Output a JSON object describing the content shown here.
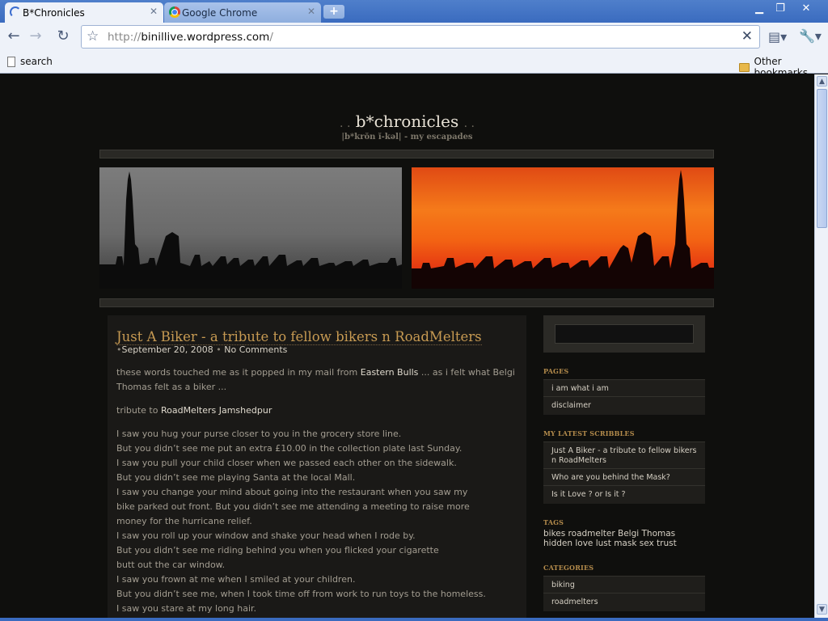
{
  "browser": {
    "tabs": [
      {
        "label": "B*Chronicles",
        "active": true
      },
      {
        "label": "Google Chrome",
        "active": false
      }
    ],
    "url_scheme": "http://",
    "url_host": "binillive.wordpress.com",
    "url_path": "/",
    "bookmarks": {
      "left_item": "search",
      "right_item": "Other bookmarks"
    }
  },
  "site": {
    "title_dots_left": ". .",
    "title": "b*chronicles",
    "title_dots_right": ". .",
    "subtitle": "|b*krŏn ĭ-kəl|  - my escapades"
  },
  "post": {
    "title": "Just A Biker - a tribute to fellow bikers n RoadMelters",
    "meta_bullet": "•",
    "date": "September 20, 2008",
    "meta_sep": "•",
    "comments": "No Comments",
    "intro_pre": "these words touched me as it popped in my mail from ",
    "intro_link": "Eastern Bulls",
    "intro_post": " ... as i felt what Belgi Thomas felt as a biker ...",
    "tribute_pre": "tribute to ",
    "tribute_link": "RoadMelters Jamshedpur",
    "poem": [
      "I saw you hug your purse closer to you in the grocery store line.",
      "But you didn’t see me put an extra £10.00 in the collection plate last Sunday.",
      "I saw you pull your child closer when we passed each other on the sidewalk.",
      "But you didn’t see me playing Santa at the local Mall.",
      "I saw you change your mind about going into the restaurant when you saw my",
      "bike parked out front. But you didn’t see me attending a meeting to raise more",
      "money for the hurricane relief.",
      "I saw you roll up your window and shake your head when I rode by.",
      "But you didn’t see me riding behind you when you flicked your cigarette",
      "butt out the car window.",
      "I saw you frown at me when I smiled at your children.",
      "But you didn’t see me, when I took time off from work to run toys to the homeless.",
      "I saw you stare at my long hair."
    ]
  },
  "sidebar": {
    "pages_heading": "PAGES",
    "pages": [
      "i am what i am",
      "disclaimer"
    ],
    "latest_heading": "MY LATEST SCRIBBLES",
    "latest": [
      "Just A Biker - a tribute to fellow bikers n RoadMelters",
      "Who are you behind the Mask?",
      "Is it Love ? or Is it ?"
    ],
    "tags_heading": "TAGS",
    "tags": "bikes roadmelter Belgi Thomas hidden love lust mask sex trust",
    "categories_heading": "CATEGORIES",
    "categories": [
      "biking",
      "roadmelters"
    ]
  }
}
